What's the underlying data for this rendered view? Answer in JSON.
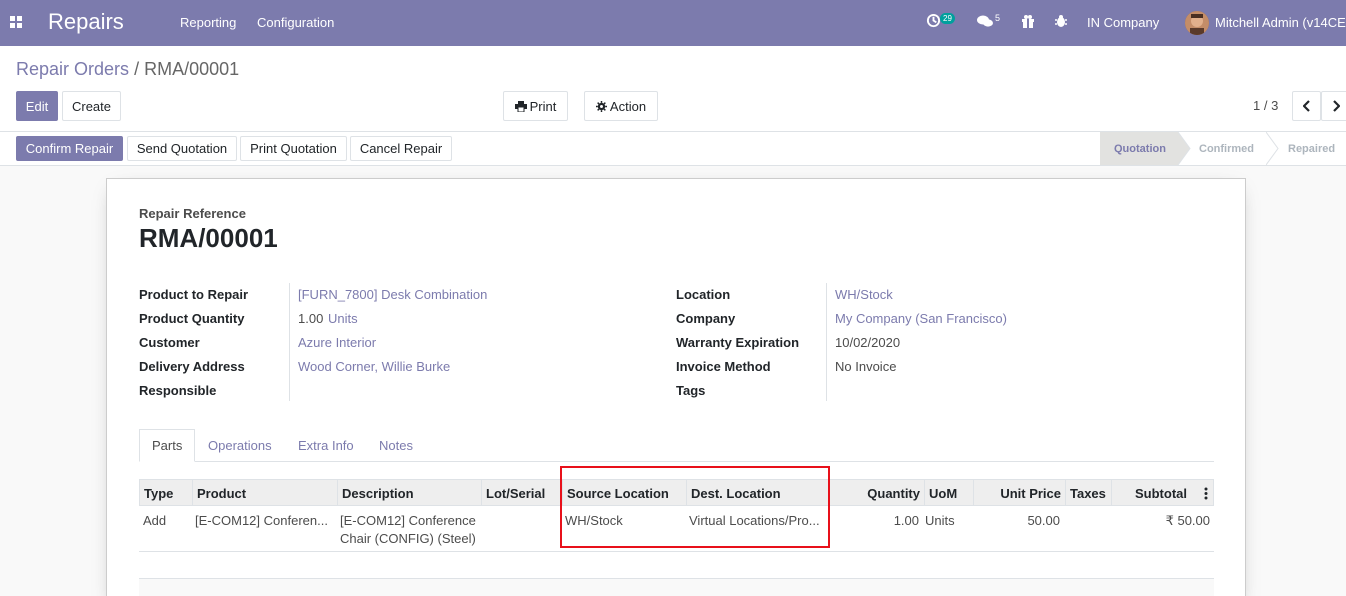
{
  "navbar": {
    "brand": "Repairs",
    "menu": [
      "Reporting",
      "Configuration"
    ],
    "activity_count": "29",
    "messages_count": "5",
    "company": "IN Company",
    "user": "Mitchell Admin (v14CE"
  },
  "breadcrumb": {
    "parent": "Repair Orders",
    "separator": "/",
    "current": "RMA/00001"
  },
  "buttons": {
    "edit": "Edit",
    "create": "Create",
    "print": "Print",
    "action": "Action"
  },
  "pager": "1 / 3",
  "statusbar": {
    "actions": [
      "Confirm Repair",
      "Send Quotation",
      "Print Quotation",
      "Cancel Repair"
    ],
    "steps": [
      "Quotation",
      "Confirmed",
      "Repaired"
    ],
    "active_step": "Quotation"
  },
  "form": {
    "ref_label": "Repair Reference",
    "ref_value": "RMA/00001",
    "left": [
      {
        "label": "Product to Repair",
        "value": "[FURN_7800] Desk Combination"
      },
      {
        "label": "Product Quantity",
        "value": "1.00",
        "unit": "Units"
      },
      {
        "label": "Customer",
        "value": "Azure Interior"
      },
      {
        "label": "Delivery Address",
        "value": "Wood Corner, Willie Burke"
      },
      {
        "label": "Responsible",
        "value": ""
      }
    ],
    "right": [
      {
        "label": "Location",
        "value": "WH/Stock"
      },
      {
        "label": "Company",
        "value": "My Company (San Francisco)"
      },
      {
        "label": "Warranty Expiration",
        "value": "10/02/2020"
      },
      {
        "label": "Invoice Method",
        "value": "No Invoice"
      },
      {
        "label": "Tags",
        "value": ""
      }
    ]
  },
  "tabs": [
    "Parts",
    "Operations",
    "Extra Info",
    "Notes"
  ],
  "table": {
    "headers": [
      "Type",
      "Product",
      "Description",
      "Lot/Serial",
      "Source Location",
      "Dest. Location",
      "Quantity",
      "UoM",
      "Unit Price",
      "Taxes",
      "Subtotal"
    ],
    "rows": [
      {
        "type": "Add",
        "product": "[E-COM12] Conferen...",
        "description_1": "[E-COM12] Conference",
        "description_2": "Chair (CONFIG) (Steel)",
        "lot": "",
        "source": "WH/Stock",
        "dest": "Virtual Locations/Pro...",
        "quantity": "1.00",
        "uom": "Units",
        "unit_price": "50.00",
        "taxes": "",
        "subtotal": "₹ 50.00"
      }
    ]
  },
  "colors": {
    "brand": "#7c7bad",
    "highlight": "#e8101a"
  }
}
